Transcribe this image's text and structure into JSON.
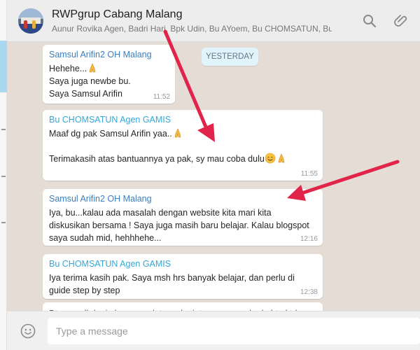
{
  "header": {
    "title": "RWPgrup Cabang Malang",
    "subtitle": "Aunur Rovika Agen, Badri Hari, Bpk Udin, Bu AYoem, Bu CHOMSATUN, Bu N...",
    "icons": [
      "search-icon",
      "paperclip-icon"
    ]
  },
  "date_divider": "YESTERDAY",
  "messages": [
    {
      "sender": "Samsul Arifin2 OH Malang",
      "lines": [
        "Hehehe...",
        "Saya juga newbe bu.",
        "Saya Samsul Arifin"
      ],
      "time": "11:52"
    },
    {
      "sender": "Bu CHOMSATUN Agen GAMIS",
      "lines": [
        "Maaf dg pak Samsul Arifin yaa..",
        "",
        "Terimakasih atas bantuannya ya pak, sy mau coba dulu"
      ],
      "time": "11:55"
    },
    {
      "sender": "Samsul Arifin2 OH Malang",
      "lines": [
        "Iya, bu...kalau ada masalah dengan website kita mari kita",
        "diskusikan bersama ! Saya juga masih baru belajar. Kalau blogspot",
        "saya sudah mid, hehhhehe..."
      ],
      "time": "12:16"
    },
    {
      "sender": "Bu CHOMSATUN Agen GAMIS",
      "lines": [
        "Iya terima kasih pak. Saya msh hrs banyak belajar, dan perlu di",
        "guide step by step"
      ],
      "time": "12:38"
    },
    {
      "lines": [
        "Btw sy sdh login ke c panel, trs selanjutnya pasang kode html td..."
      ]
    }
  ],
  "composer": {
    "placeholder": "Type a message",
    "value": ""
  },
  "colors": {
    "chat_bg": "#e5ddd5",
    "header_bg": "#ededed",
    "bubble": "#ffffff",
    "arrow": "#e0244a"
  }
}
